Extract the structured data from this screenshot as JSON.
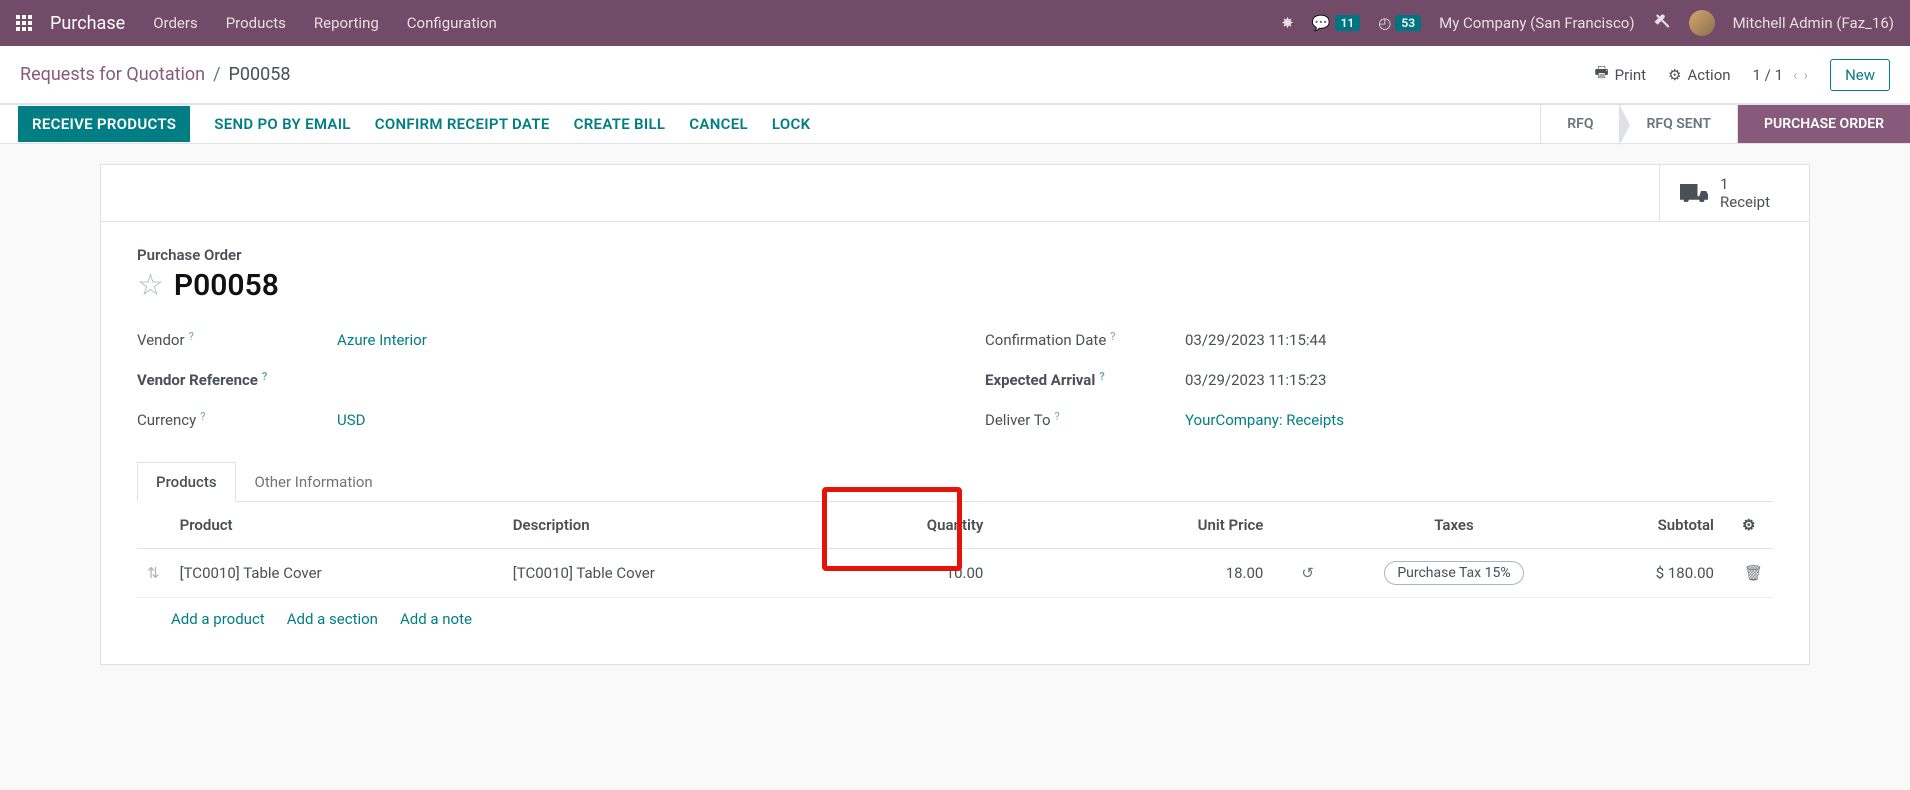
{
  "topnav": {
    "brand": "Purchase",
    "menu": [
      "Orders",
      "Products",
      "Reporting",
      "Configuration"
    ],
    "msg_badge": "11",
    "activity_badge": "53",
    "company": "My Company (San Francisco)",
    "user": "Mitchell Admin (Faz_16)"
  },
  "controlbar": {
    "breadcrumb_root": "Requests for Quotation",
    "breadcrumb_current": "P00058",
    "print": "Print",
    "action": "Action",
    "pager": "1 / 1",
    "new": "New"
  },
  "statusbar": {
    "buttons": [
      "RECEIVE PRODUCTS",
      "SEND PO BY EMAIL",
      "CONFIRM RECEIPT DATE",
      "CREATE BILL",
      "CANCEL",
      "LOCK"
    ],
    "stages": [
      "RFQ",
      "RFQ SENT",
      "PURCHASE ORDER"
    ]
  },
  "stat": {
    "count": "1",
    "label": "Receipt"
  },
  "form": {
    "title_label": "Purchase Order",
    "title": "P00058",
    "vendor_label": "Vendor",
    "vendor": "Azure Interior",
    "vendor_ref_label": "Vendor Reference",
    "currency_label": "Currency",
    "currency": "USD",
    "confirm_date_label": "Confirmation Date",
    "confirm_date": "03/29/2023 11:15:44",
    "expected_label": "Expected Arrival",
    "expected": "03/29/2023 11:15:23",
    "deliver_label": "Deliver To",
    "deliver": "YourCompany: Receipts"
  },
  "tabs": [
    "Products",
    "Other Information"
  ],
  "table": {
    "headers": {
      "product": "Product",
      "description": "Description",
      "quantity": "Quantity",
      "unit_price": "Unit Price",
      "taxes": "Taxes",
      "subtotal": "Subtotal"
    },
    "rows": [
      {
        "product": "[TC0010] Table Cover",
        "description": "[TC0010] Table Cover",
        "quantity": "10.00",
        "unit_price": "18.00",
        "taxes": "Purchase Tax 15%",
        "subtotal": "$ 180.00"
      }
    ],
    "add_product": "Add a product",
    "add_section": "Add a section",
    "add_note": "Add a note"
  }
}
